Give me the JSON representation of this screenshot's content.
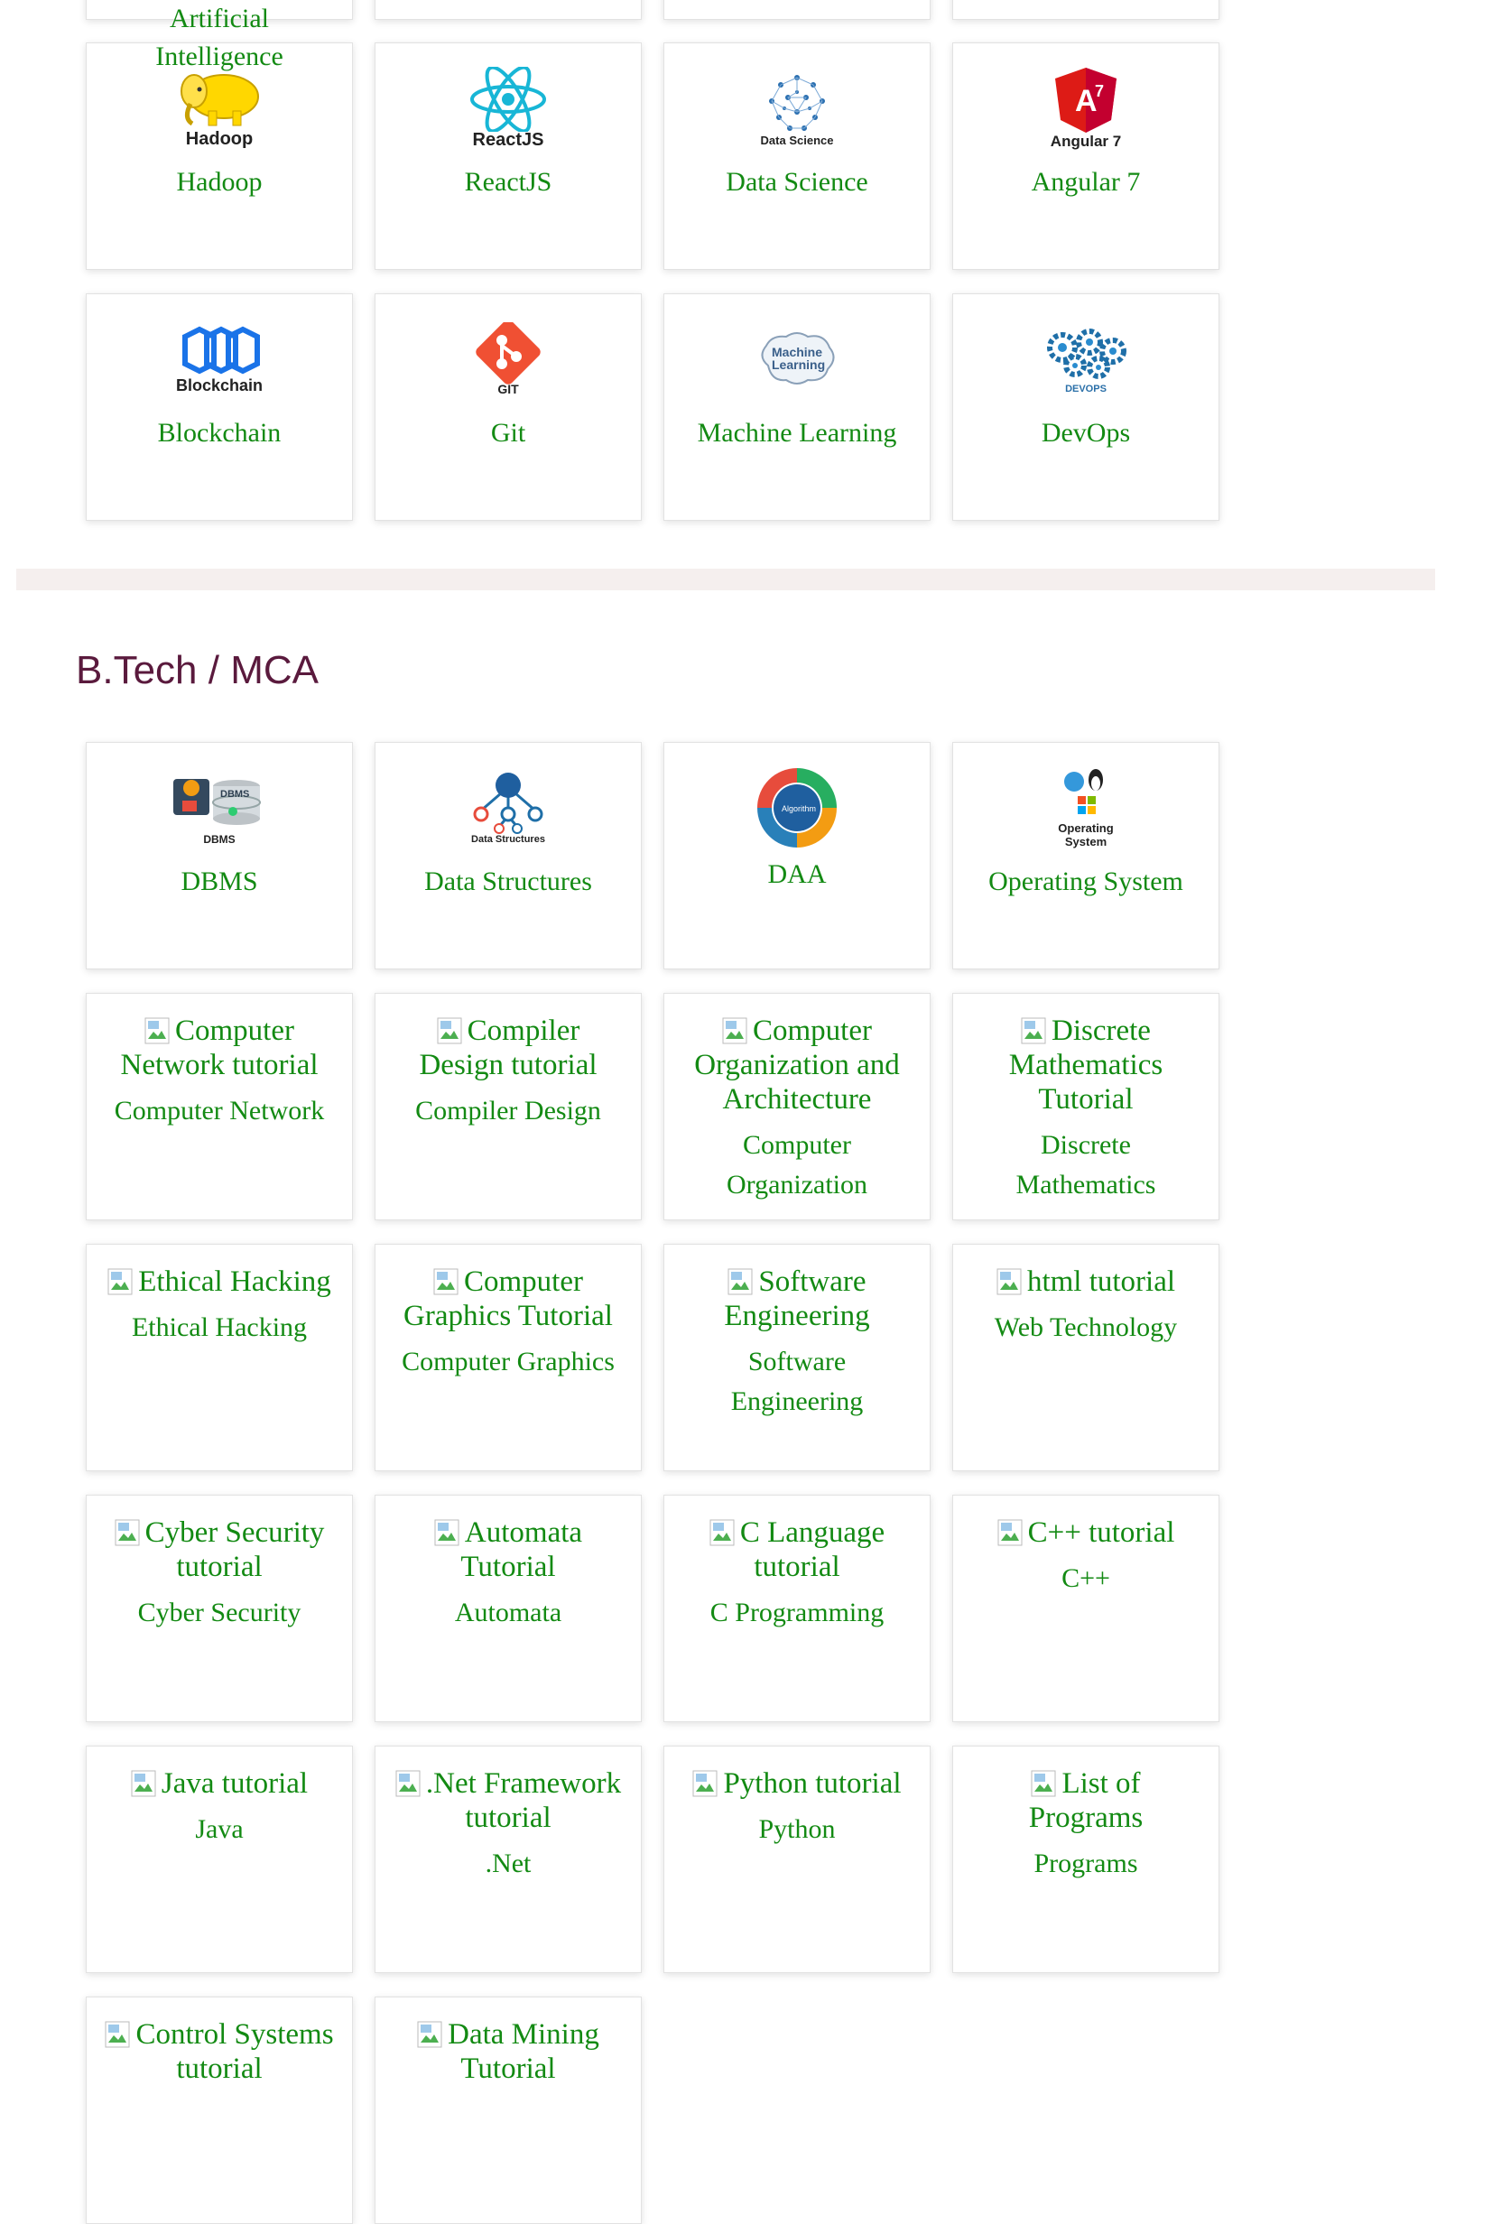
{
  "top_row": {
    "partial_labels": [
      "Artificial",
      "Intelligence"
    ]
  },
  "section1": {
    "cards": [
      {
        "logo": "hadoop-logo",
        "logo_text": "Hadoop",
        "label": "Hadoop"
      },
      {
        "logo": "react-logo",
        "logo_text": "ReactJS",
        "label": "ReactJS"
      },
      {
        "logo": "data-science-logo",
        "logo_text": "Data Science",
        "label": "Data Science"
      },
      {
        "logo": "angular-logo",
        "logo_text": "Angular 7",
        "label": "Angular 7"
      },
      {
        "logo": "blockchain-logo",
        "logo_text": "Blockchain",
        "label": "Blockchain"
      },
      {
        "logo": "git-logo",
        "logo_text": "GIT",
        "label": "Git"
      },
      {
        "logo": "machine-learning-logo",
        "logo_text": "Machine Learning",
        "label": "Machine Learning"
      },
      {
        "logo": "devops-logo",
        "logo_text": "DEVOPS",
        "label": "DevOps"
      }
    ]
  },
  "section2": {
    "title": "B.Tech / MCA",
    "logo_cards": [
      {
        "logo": "dbms-logo",
        "logo_text": "DBMS",
        "label": "DBMS"
      },
      {
        "logo": "data-structures-logo",
        "logo_text": "Data Structures",
        "label": "Data Structures"
      },
      {
        "logo": "daa-logo",
        "logo_text": "",
        "label": "DAA"
      },
      {
        "logo": "operating-system-logo",
        "logo_text": "Operating System",
        "label": "Operating System"
      }
    ],
    "alt_cards": [
      {
        "alt": "Computer Network tutorial",
        "label": "Computer Network"
      },
      {
        "alt": "Compiler Design tutorial",
        "label": "Compiler Design"
      },
      {
        "alt": "Computer Organization and Architecture",
        "label": "Computer Organization"
      },
      {
        "alt": "Discrete Mathematics Tutorial",
        "label": "Discrete Mathematics"
      },
      {
        "alt": "Ethical Hacking",
        "label": "Ethical Hacking"
      },
      {
        "alt": "Computer Graphics Tutorial",
        "label": "Computer Graphics"
      },
      {
        "alt": "Software Engineering",
        "label": "Software Engineering"
      },
      {
        "alt": "html tutorial",
        "label": "Web Technology"
      },
      {
        "alt": "Cyber Security tutorial",
        "label": "Cyber Security"
      },
      {
        "alt": "Automata Tutorial",
        "label": "Automata"
      },
      {
        "alt": "C Language tutorial",
        "label": "C Programming"
      },
      {
        "alt": "C++ tutorial",
        "label": "C++"
      },
      {
        "alt": "Java tutorial",
        "label": "Java"
      },
      {
        "alt": ".Net Framework tutorial",
        "label": ".Net"
      },
      {
        "alt": "Python tutorial",
        "label": "Python"
      },
      {
        "alt": "List of Programs",
        "label": "Programs"
      },
      {
        "alt": "Control Systems tutorial",
        "label": ""
      },
      {
        "alt": "Data Mining Tutorial",
        "label": ""
      }
    ]
  },
  "colors": {
    "link": "#138a13",
    "section_title": "#5a1a3d",
    "divider": "#f5efee"
  }
}
